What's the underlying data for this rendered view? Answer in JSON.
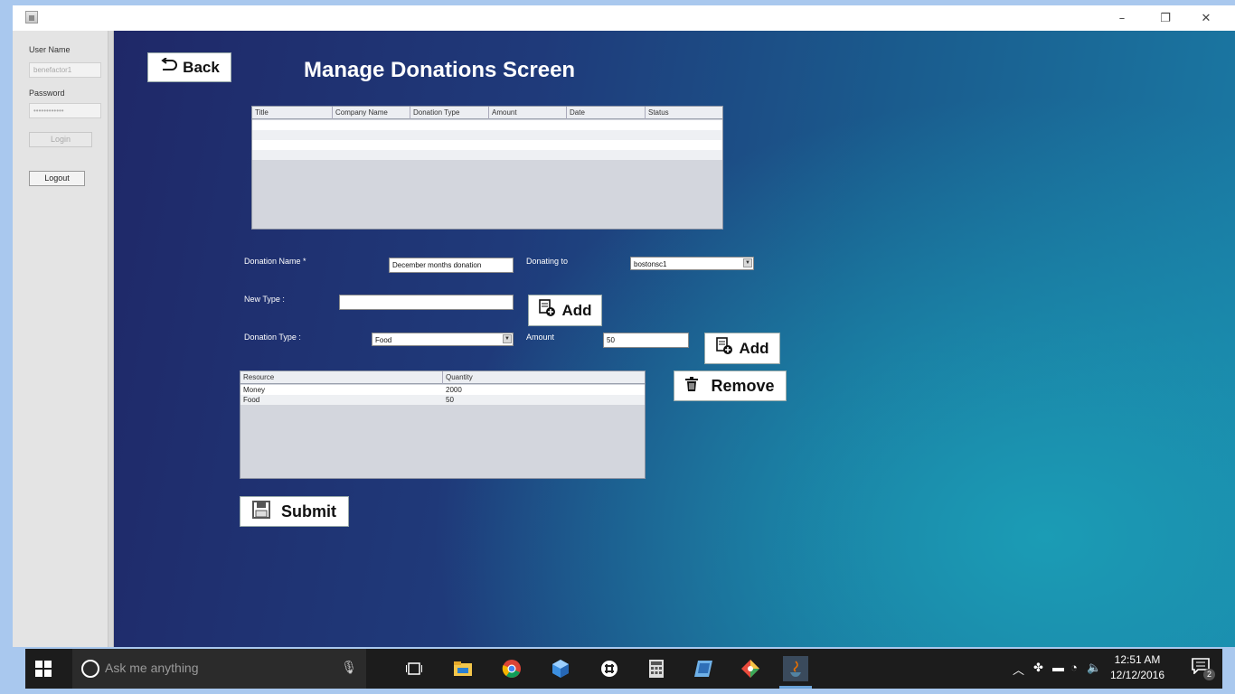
{
  "window": {
    "minimize_glyph": "–",
    "restore_glyph": "❐",
    "close_glyph": "✕"
  },
  "left_panel": {
    "username_label": "User Name",
    "username_value": "benefactor1",
    "password_label": "Password",
    "password_value": "••••••••••••",
    "login_label": "Login",
    "logout_label": "Logout"
  },
  "header": {
    "back_label": "Back",
    "title": "Manage Donations Screen"
  },
  "donations_table": {
    "columns": [
      "Title",
      "Company Name",
      "Donation Type",
      "Amount",
      "Date",
      "Status"
    ]
  },
  "form": {
    "donation_name_label": "Donation Name *",
    "donation_name_value": "December months donation",
    "donating_to_label": "Donating to",
    "donating_to_value": "bostonsc1",
    "new_type_label": "New Type :",
    "new_type_value": "",
    "add_type_label": "Add",
    "donation_type_label": "Donation Type :",
    "donation_type_value": "Food",
    "amount_label": "Amount",
    "amount_value": "50",
    "add_resource_label": "Add",
    "remove_label": "Remove",
    "submit_label": "Submit"
  },
  "resources_table": {
    "columns": [
      "Resource",
      "Quantity"
    ],
    "rows": [
      {
        "resource": "Money",
        "quantity": "2000"
      },
      {
        "resource": "Food",
        "quantity": "50"
      }
    ]
  },
  "taskbar": {
    "search_placeholder": "Ask me anything",
    "time": "12:51 AM",
    "date": "12/12/2016",
    "notification_count": "2"
  }
}
